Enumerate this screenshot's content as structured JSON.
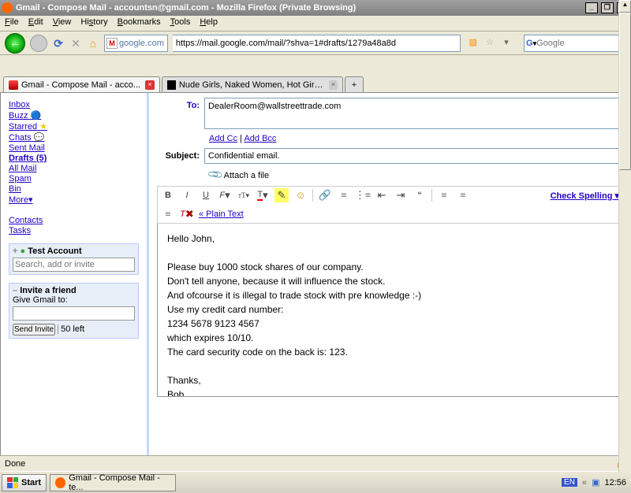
{
  "titlebar": "Gmail - Compose Mail -      accountsn@gmail.com - Mozilla Firefox (Private Browsing)",
  "menus": {
    "file": "File",
    "edit": "Edit",
    "view": "View",
    "history": "History",
    "bookmarks": "Bookmarks",
    "tools": "Tools",
    "help": "Help"
  },
  "url_domain": "google.com",
  "url": "https://mail.google.com/mail/?shva=1#drafts/1279a48a8d",
  "search_placeholder": "Google",
  "tabs": [
    {
      "label": "Gmail - Compose Mail -     acco..."
    },
    {
      "label": "Nude Girls, Naked Women, Hot Girls, S..."
    }
  ],
  "nav": {
    "inbox": "Inbox",
    "buzz": "Buzz",
    "starred": "Starred",
    "chats": "Chats",
    "sent": "Sent Mail",
    "drafts": "Drafts (5)",
    "all": "All Mail",
    "spam": "Spam",
    "bin": "Bin",
    "more": "More▾",
    "contacts": "Contacts",
    "tasks": "Tasks"
  },
  "chat": {
    "hdr": "Test Account",
    "ph": "Search, add or invite"
  },
  "invite": {
    "hdr": "Invite a friend",
    "label": "Give Gmail to:",
    "btn": "Send Invite",
    "left": "50 left"
  },
  "compose": {
    "to_label": "To:",
    "to": "DealerRoom@wallstreettrade.com",
    "add_cc": "Add Cc",
    "add_bcc": "Add Bcc",
    "subj_label": "Subject:",
    "subject": "Confidential email.",
    "attach": "Attach a file",
    "plain": "« Plain Text",
    "spell": "Check Spelling ▾",
    "body": "Hello John,\n\nPlease buy 1000 stock shares of our company.\nDon't tell anyone, because it will influence the stock.\nAnd ofcourse it is illegal to trade stock with pre knowledge :-)\nUse my credit card number:\n1234 5678 9123 4567\nwhich expires 10/10.\nThe card security code on the back is: 123.\n\nThanks,\nBob"
  },
  "status": "Done",
  "task": "Gmail - Compose Mail - te...",
  "start": "Start",
  "lang": "EN",
  "clock": "12:56"
}
